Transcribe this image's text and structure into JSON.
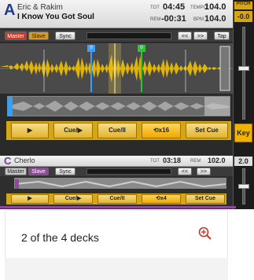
{
  "deckA": {
    "letter": "A",
    "artist": "Eric & Rakim",
    "title": "I Know You Got Soul",
    "tot_label": "TOT",
    "time": "04:45",
    "rem_label": "REM",
    "remaining": "-00:31",
    "bpm_label_top": "TEMPO",
    "tempo": "104.0",
    "bpm_label": "BPM",
    "bpm": "104.0",
    "pitch_label": "PITCH",
    "pitch": "-0.0",
    "buttons": {
      "master": "Master",
      "slave": "Slave",
      "sync": "Sync",
      "rewind": "<<",
      "forward": ">>",
      "tap": "Tap"
    },
    "cue_marker_1": "0",
    "cue_marker_2": "0",
    "transport": {
      "play": "▶",
      "cue_play": "Cue/▶",
      "cue_pause": "Cue/II",
      "loop": "⟲x16",
      "set_cue": "Set Cue"
    },
    "key": "Key",
    "colors": {
      "accent": "#d6a614",
      "wave": "#f0c000",
      "deck_letter": "#1f3e8c"
    }
  },
  "deckC": {
    "letter": "C",
    "artist": "Cherlo",
    "tot_label": "TOT",
    "time": "03:18",
    "rem_label": "REM",
    "tempo": "102.0",
    "pitch": "2.0",
    "buttons": {
      "master": "Master",
      "slave": "Slave",
      "sync": "Sync",
      "rewind": "<<",
      "forward": ">>"
    },
    "transport": {
      "play": "▶",
      "cue_play": "Cue/▶",
      "cue_pause": "Cue/II",
      "loop": "⟲x4",
      "set_cue": "Set Cue"
    },
    "colors": {
      "accent": "#8d4a98",
      "deck_letter": "#6a3c8a"
    }
  },
  "caption": {
    "text": "2 of the 4 decks",
    "zoom_icon": "zoom-in-icon"
  }
}
